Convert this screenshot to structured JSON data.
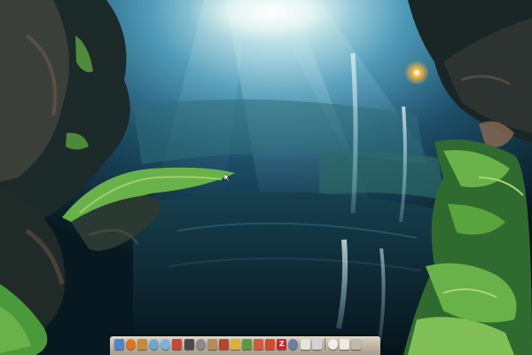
{
  "desktop": {
    "wallpaper": "cave-sinkhole-waterfall",
    "colors": {
      "sky_glow": "#f4fbf8",
      "mist": "#4e9ab8",
      "moss": "#69b24a",
      "rock": "#1c2a2a",
      "lamp": "#f6b23a"
    }
  },
  "dock": {
    "items": [
      {
        "icon": "finder-icon",
        "color": "#4f86c9",
        "shape": "square"
      },
      {
        "icon": "firefox-icon",
        "color": "#e2731f",
        "shape": "round"
      },
      {
        "icon": "mail-icon",
        "color": "#c58a3b",
        "shape": "square"
      },
      {
        "icon": "safari-icon",
        "color": "#6aa7d8",
        "shape": "round"
      },
      {
        "icon": "itunes-icon",
        "color": "#7bb3dc",
        "shape": "round"
      },
      {
        "icon": "photo-icon",
        "color": "#c7473b",
        "shape": "square"
      },
      {
        "icon": "terminal-icon",
        "color": "#4a4a4a",
        "shape": "square"
      },
      {
        "icon": "preferences-icon",
        "color": "#8a8a8a",
        "shape": "round"
      },
      {
        "icon": "address-book-icon",
        "color": "#b08d5a",
        "shape": "square"
      },
      {
        "icon": "photo-booth-icon",
        "color": "#b9442e",
        "shape": "square"
      },
      {
        "icon": "star-icon",
        "color": "#d9b23a",
        "shape": "square"
      },
      {
        "icon": "leaf-icon",
        "color": "#5b9a3d",
        "shape": "square"
      },
      {
        "icon": "calendar-icon",
        "color": "#cf5a3e",
        "shape": "square"
      },
      {
        "icon": "flag-icon",
        "color": "#d24b2c",
        "shape": "square"
      },
      {
        "icon": "filezilla-icon",
        "color": "#c9262a",
        "shape": "square",
        "label": "Z"
      },
      {
        "icon": "globe-icon",
        "color": "#6b7fa6",
        "shape": "round"
      },
      {
        "icon": "document-icon",
        "color": "#e9e4da",
        "shape": "square"
      },
      {
        "icon": "preview-icon",
        "color": "#d3d3d3",
        "shape": "square"
      },
      {
        "icon": "separator"
      },
      {
        "icon": "download-icon",
        "color": "#f0eee8",
        "shape": "round"
      },
      {
        "icon": "text-document-icon",
        "color": "#eeeae2",
        "shape": "square"
      },
      {
        "icon": "trash-icon",
        "color": "#bfb9ae",
        "shape": "square"
      }
    ]
  }
}
